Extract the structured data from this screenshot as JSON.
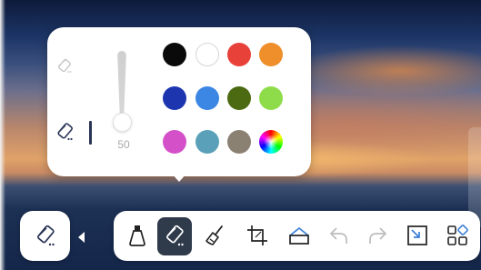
{
  "pen_size": {
    "value": "50"
  },
  "colors": [
    {
      "name": "black",
      "hex": "#0a0a0a"
    },
    {
      "name": "white",
      "hex": "#ffffff"
    },
    {
      "name": "red",
      "hex": "#e8413a"
    },
    {
      "name": "orange",
      "hex": "#ee8f2b"
    },
    {
      "name": "dark-blue",
      "hex": "#1d36b0"
    },
    {
      "name": "blue",
      "hex": "#3c86e4"
    },
    {
      "name": "dark-green",
      "hex": "#4b6a12"
    },
    {
      "name": "light-green",
      "hex": "#8fdc4a"
    },
    {
      "name": "magenta",
      "hex": "#d450c8"
    },
    {
      "name": "teal",
      "hex": "#5aa0b8"
    },
    {
      "name": "gray",
      "hex": "#8b8173"
    },
    {
      "name": "custom",
      "hex": "multicolor"
    }
  ],
  "toolbar": {
    "tools": [
      "ink-bottle-icon",
      "eraser-icon",
      "broom-icon",
      "crop-icon",
      "shape-icon",
      "undo-icon",
      "redo-icon",
      "resize-icon",
      "apps-icon"
    ],
    "active_tool": "eraser-icon"
  },
  "accent": "#2f3a4b"
}
